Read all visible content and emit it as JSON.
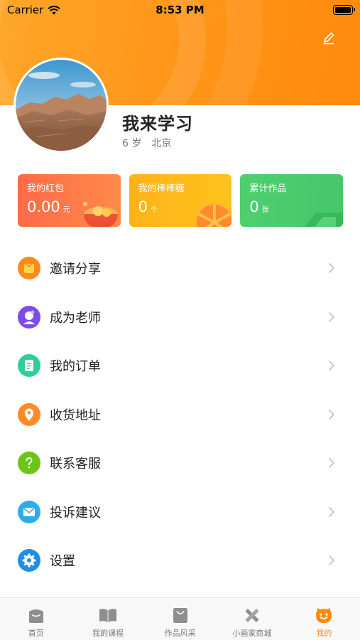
{
  "status_bar": {
    "carrier": "Carrier",
    "time": "8:53 PM"
  },
  "profile": {
    "name": "我来学习",
    "age": "6 岁",
    "city": "北京"
  },
  "cards": [
    {
      "title": "我的红包",
      "value": "0.00",
      "unit": "元",
      "color": "#ff6a4a"
    },
    {
      "title": "我的棒棒糖",
      "value": "0",
      "unit": "个",
      "color": "#ffb31a"
    },
    {
      "title": "累计作品",
      "value": "0",
      "unit": "张",
      "color": "#4fcf6e"
    }
  ],
  "menu": [
    {
      "label": "邀请分享",
      "icon": "gift-icon",
      "color": "#ff8a1c"
    },
    {
      "label": "成为老师",
      "icon": "teacher-icon",
      "color": "#7d4ce8"
    },
    {
      "label": "我的订单",
      "icon": "order-icon",
      "color": "#2fcf9a"
    },
    {
      "label": "收货地址",
      "icon": "location-icon",
      "color": "#ff8a2a"
    },
    {
      "label": "联系客服",
      "icon": "help-icon",
      "color": "#6cc417"
    },
    {
      "label": "投诉建议",
      "icon": "mail-icon",
      "color": "#2aaee8"
    },
    {
      "label": "设置",
      "icon": "settings-icon",
      "color": "#1e8fe8"
    }
  ],
  "tabs": [
    {
      "label": "首页",
      "icon": "home-icon"
    },
    {
      "label": "我的课程",
      "icon": "book-icon"
    },
    {
      "label": "作品风采",
      "icon": "bag-icon"
    },
    {
      "label": "小画家商城",
      "icon": "pencil-ruler-icon"
    },
    {
      "label": "我的",
      "icon": "smiley-icon",
      "active": true
    }
  ],
  "accent_color": "#ff8a0c"
}
